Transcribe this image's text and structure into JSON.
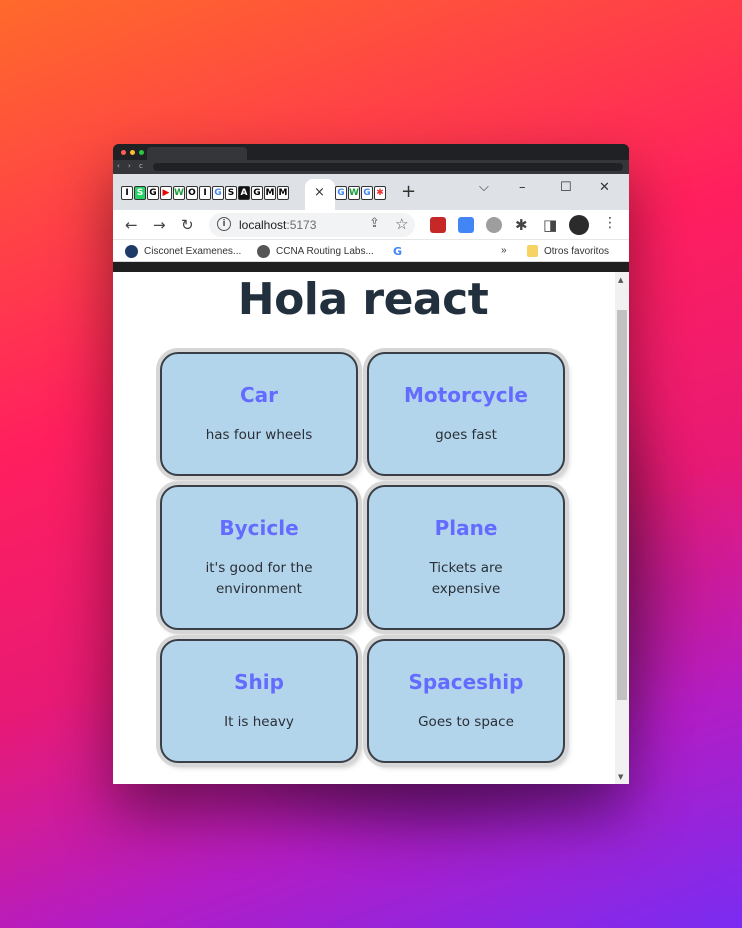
{
  "browser": {
    "tab_favicons_left": [
      "I",
      "S",
      "G",
      "▶",
      "W",
      "O",
      "I",
      "G",
      "S",
      "A",
      "G",
      "M",
      "M"
    ],
    "tab_favicons_right": [
      "G",
      "W",
      "G",
      "✱"
    ],
    "active_tab_close": "×",
    "new_tab": "+",
    "window_controls": {
      "tab_search": "⌵",
      "minimize": "–",
      "maximize": "☐",
      "close": "✕"
    },
    "toolbar": {
      "back": "←",
      "forward": "→",
      "reload": "↻",
      "share": "⇪",
      "bookmark_star": "☆",
      "extensions": "✱",
      "sidebar": "◨",
      "menu": "⋮"
    },
    "url_host": "localhost",
    "url_port": ":5173",
    "bookmarks": [
      "Cisconet Examenes...",
      "CCNA Routing Labs..."
    ],
    "bookmarks_more": "»",
    "other_bookmarks": "Otros favoritos"
  },
  "page": {
    "heading": "Hola react",
    "cards": [
      {
        "title": "Car",
        "description": "has four wheels"
      },
      {
        "title": "Motorcycle",
        "description": "goes fast"
      },
      {
        "title": "Bycicle",
        "description": "it's good for the environment"
      },
      {
        "title": "Plane",
        "description": "Tickets are expensive"
      },
      {
        "title": "Ship",
        "description": "It is heavy"
      },
      {
        "title": "Spaceship",
        "description": "Goes to space"
      }
    ]
  },
  "colors": {
    "card_background": "#b3d5ec",
    "card_title": "#636cff",
    "heading": "#22303e"
  }
}
